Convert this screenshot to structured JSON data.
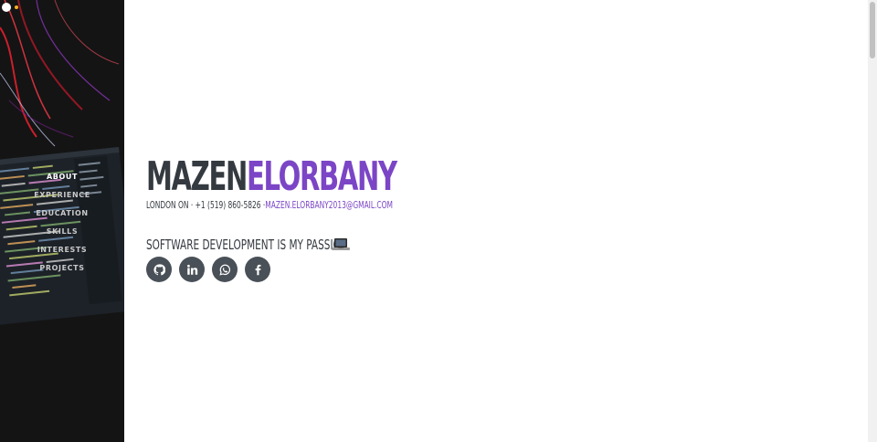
{
  "nav": {
    "items": [
      {
        "label": "About",
        "active": true
      },
      {
        "label": "Experience"
      },
      {
        "label": "Education"
      },
      {
        "label": "Skills"
      },
      {
        "label": "Interests"
      },
      {
        "label": "Projects"
      }
    ]
  },
  "hero": {
    "first_name": "MAZEN",
    "last_name": "ELORBANY",
    "contact_text": "LONDON ON · +1 (519) 860-5826 ·",
    "email": "MAZEN.ELORBANY2013@GMAIL.COM",
    "tagline": "SOFTWARE DEVELOPMENT IS MY PASSION"
  },
  "social": [
    {
      "icon": "github-icon"
    },
    {
      "icon": "linkedin-icon"
    },
    {
      "icon": "whatsapp-icon"
    },
    {
      "icon": "facebook-icon"
    }
  ],
  "colors": {
    "sidebar_bg": "#141414",
    "accent": "#7b45c6",
    "text_dark": "#343a40",
    "social_bg": "#495057"
  }
}
